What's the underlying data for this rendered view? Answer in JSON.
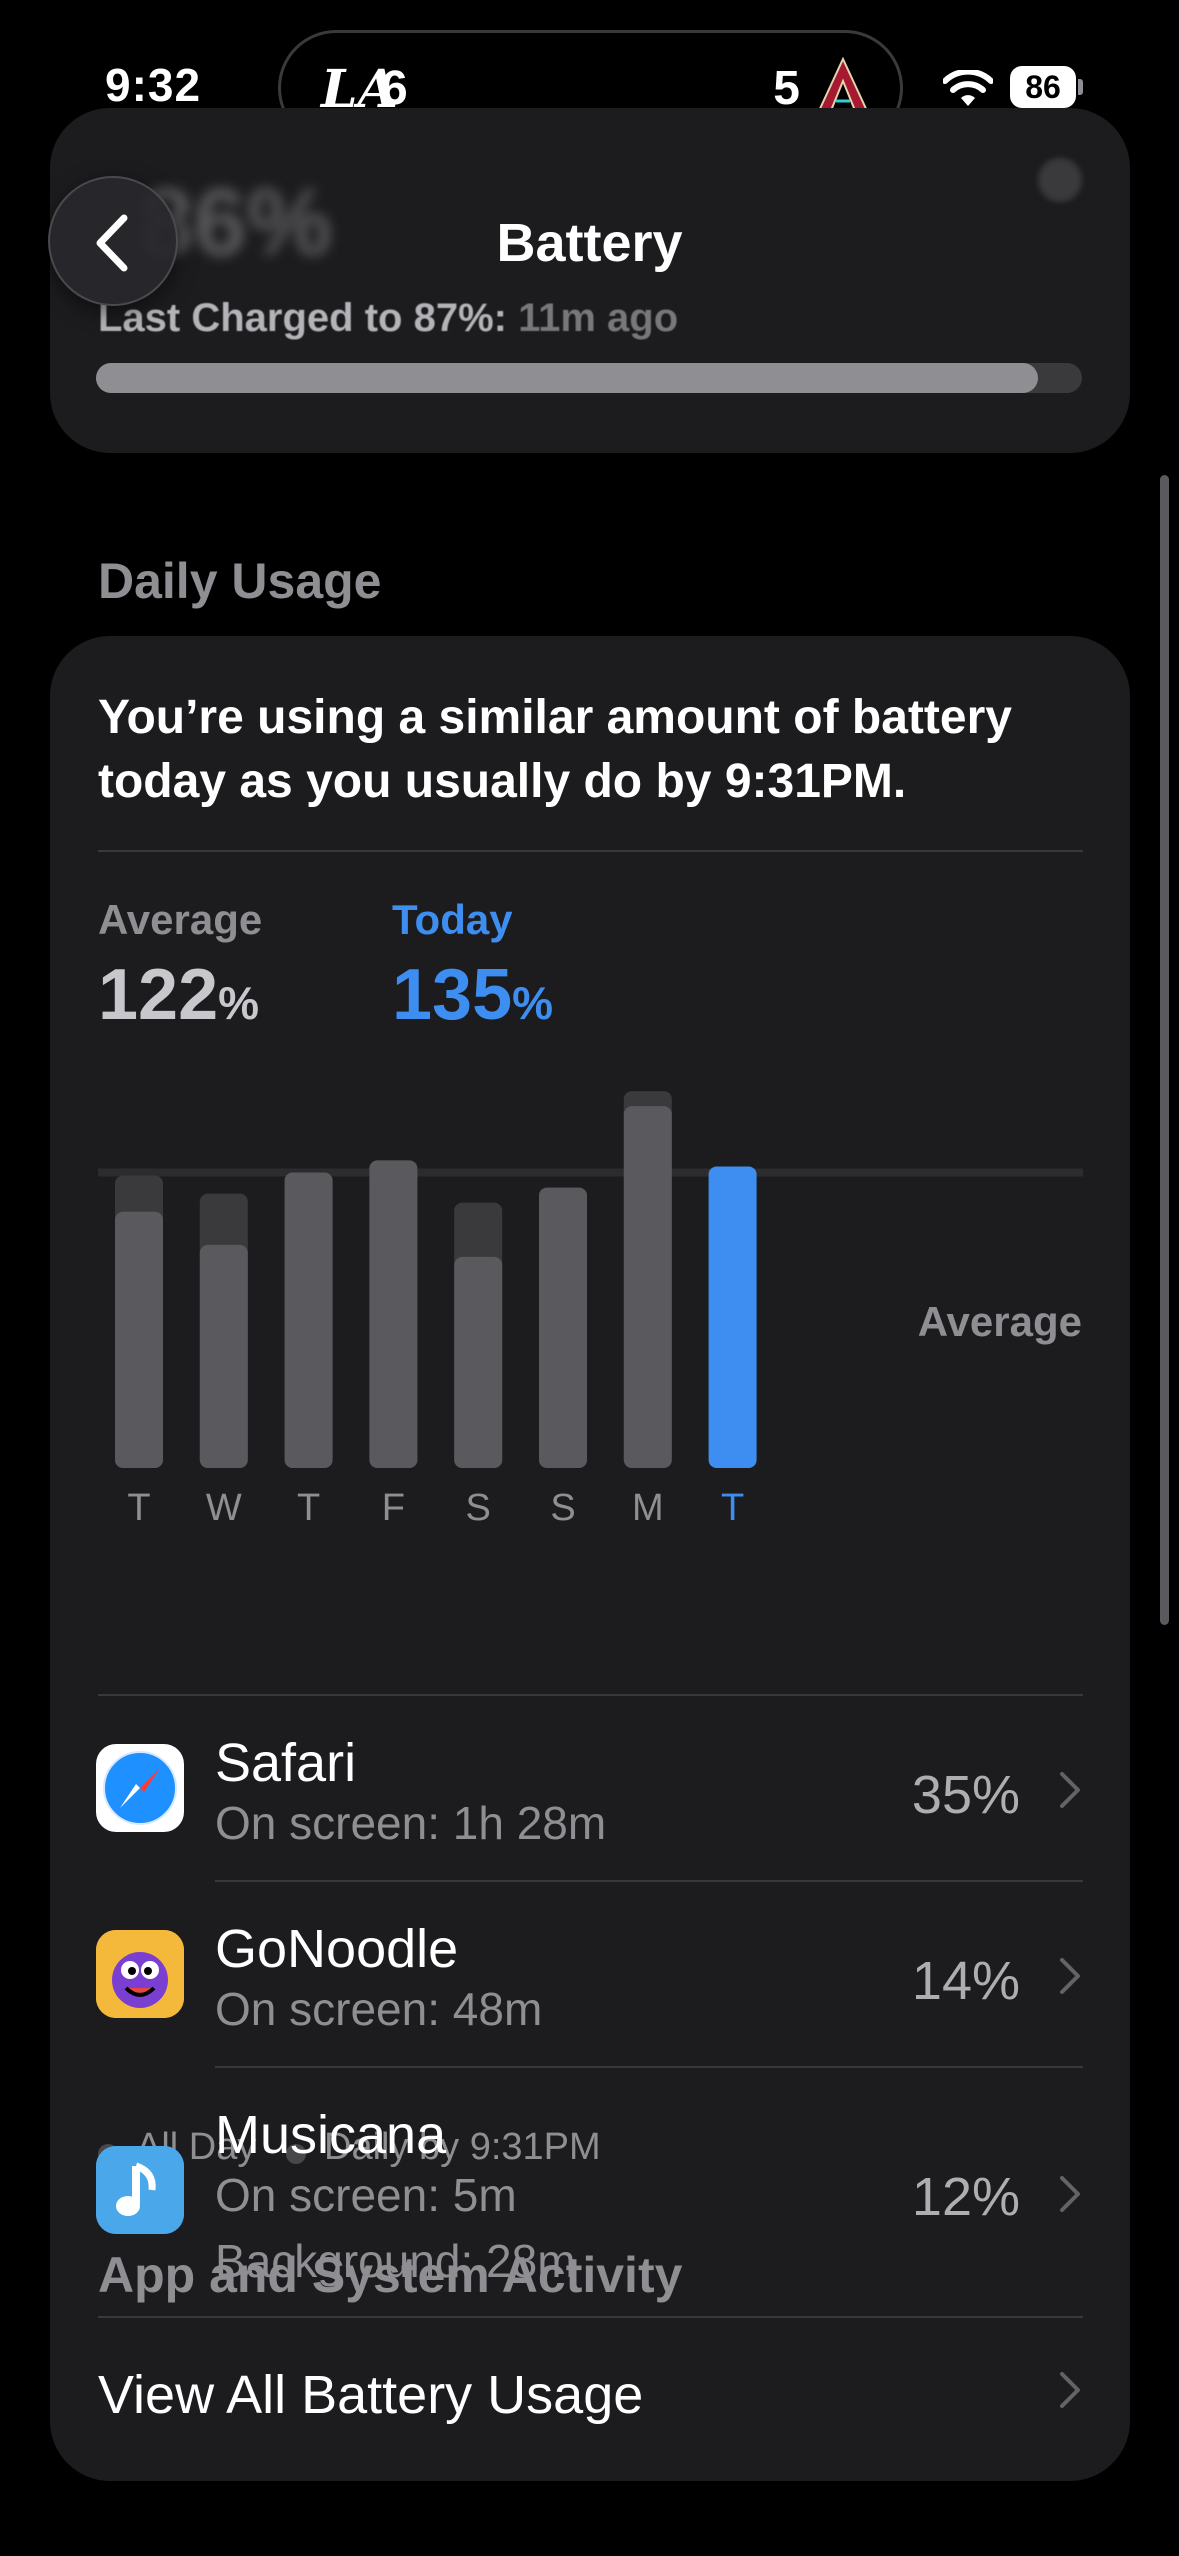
{
  "status_bar": {
    "time": "9:32",
    "live_activity": {
      "left_team": "LA",
      "left_score": "6",
      "right_score": "5",
      "right_team_icon": "diamondbacks-logo-icon"
    },
    "battery_level": "86",
    "wifi_icon": "wifi-icon"
  },
  "nav": {
    "title": "Battery",
    "back_icon": "chevron-left-icon"
  },
  "charge_card": {
    "level_text": "86%",
    "last_charged_label": "Last Charged to 87%:",
    "last_charged_ago": "11m ago",
    "level_fraction": 0.955
  },
  "daily_usage": {
    "section_title": "Daily Usage",
    "summary": "You’re using a similar amount of battery today as you usually do by 9:31PM.",
    "average_label": "Average",
    "average_value": "122",
    "today_label": "Today",
    "today_value": "135",
    "percent_sign": "%",
    "average_line_label": "Average",
    "legend": {
      "all_day": "All Day",
      "by_time": "Daily by 9:31PM"
    }
  },
  "chart_data": {
    "type": "bar",
    "categories": [
      "T",
      "W",
      "T",
      "F",
      "S",
      "S",
      "M",
      "T"
    ],
    "series": [
      {
        "name": "All Day",
        "values": [
          97,
          91,
          98,
          102,
          88,
          93,
          125,
          0
        ]
      },
      {
        "name": "Daily by 9:31PM",
        "values": [
          85,
          74,
          98,
          102,
          70,
          93,
          120,
          100
        ]
      }
    ],
    "average": 98,
    "ylim": [
      0,
      130
    ],
    "highlight_index": 7,
    "colors": {
      "all_day": "#3a3a3c",
      "by_time": "#5a5a5e",
      "today": "#3d8ef0"
    }
  },
  "activity": {
    "title": "App and System Activity",
    "apps": [
      {
        "name": "Safari",
        "sub1": "On screen: 1h 28m",
        "sub2": "",
        "percent": "35%",
        "icon": "safari-icon"
      },
      {
        "name": "GoNoodle",
        "sub1": "On screen: 48m",
        "sub2": "",
        "percent": "14%",
        "icon": "gonoodle-icon"
      },
      {
        "name": "Musicana",
        "sub1": "On screen: 5m",
        "sub2": "Background: 28m",
        "percent": "12%",
        "icon": "musicana-icon"
      }
    ],
    "view_all": "View All Battery Usage"
  }
}
